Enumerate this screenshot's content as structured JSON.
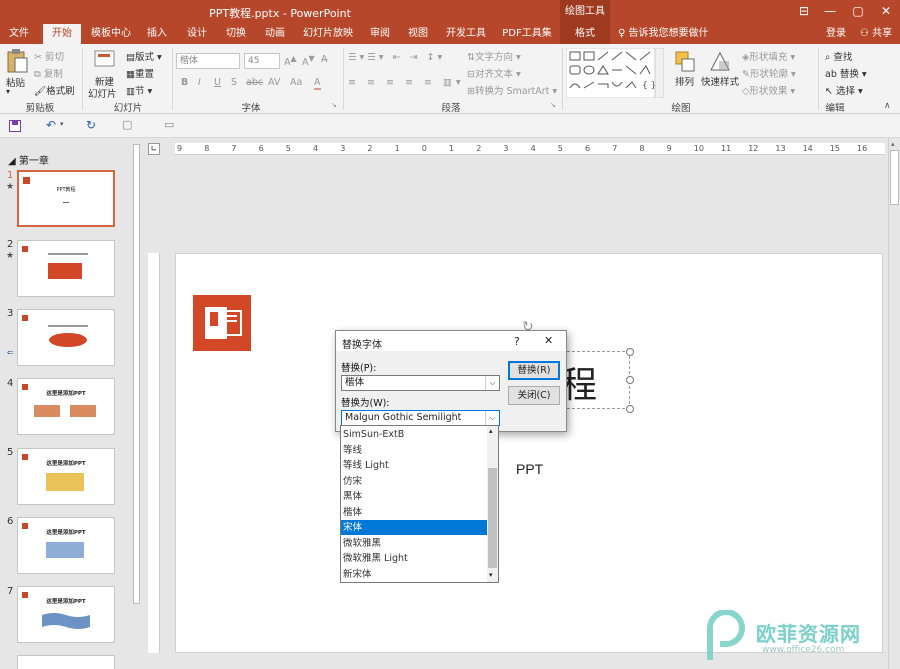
{
  "window": {
    "title": "PPT教程.pptx - PowerPoint",
    "contextual_group": "绘图工具",
    "minimize": "—",
    "restore": "▢",
    "close": "✕",
    "ribbon_options": "⊟"
  },
  "tabs": [
    "文件",
    "开始",
    "模板中心",
    "插入",
    "设计",
    "切换",
    "动画",
    "幻灯片放映",
    "审阅",
    "视图",
    "开发工具",
    "PDF工具集",
    "格式"
  ],
  "tell_me": "告诉我您想要做什么...",
  "account": {
    "login": "登录",
    "share": "共享"
  },
  "ribbon": {
    "clipboard": {
      "paste": "粘贴",
      "cut": "剪切",
      "copy": "复制",
      "format_painter": "格式刷",
      "title": "剪贴板"
    },
    "slides": {
      "new_slide": "新建",
      "new_slide2": "幻灯片",
      "layout": "版式",
      "reset": "重置",
      "section": "节",
      "title": "幻灯片"
    },
    "font": {
      "font_name": "楷体",
      "font_size": "45",
      "title": "字体",
      "bold": "B",
      "italic": "I",
      "underline": "U",
      "shadow": "S",
      "strike": "abc",
      "spacing": "AV",
      "case": "Aa",
      "color": "A"
    },
    "paragraph": {
      "text_direction": "文字方向",
      "align_text": "对齐文本",
      "smartart": "转换为 SmartArt",
      "title": "段落"
    },
    "drawing": {
      "arrange": "排列",
      "quick_styles": "快速样式",
      "shape_fill": "形状填充",
      "shape_outline": "形状轮廓",
      "shape_effects": "形状效果",
      "title": "绘图"
    },
    "editing": {
      "find": "查找",
      "replace": "替换",
      "select": "选择",
      "title": "编辑"
    }
  },
  "section_name": "第一章",
  "thumbnails": [
    {
      "num": "1",
      "star": "★",
      "caption": "PPT教程"
    },
    {
      "num": "2",
      "star": "★",
      "caption": ""
    },
    {
      "num": "3",
      "star": "",
      "caption": ""
    },
    {
      "num": "4",
      "star": "",
      "caption": "这里是添加PPT"
    },
    {
      "num": "5",
      "star": "",
      "caption": "这里是添加PPT"
    },
    {
      "num": "6",
      "star": "",
      "caption": "这里是添加PPT"
    },
    {
      "num": "7",
      "star": "",
      "caption": "这里是添加PPT"
    }
  ],
  "ruler_labels": [
    "9",
    "8",
    "7",
    "6",
    "5",
    "4",
    "3",
    "2",
    "1",
    "0",
    "1",
    "2",
    "3",
    "4",
    "5",
    "6",
    "7",
    "8",
    "9",
    "10",
    "11",
    "12",
    "13",
    "14",
    "15",
    "16"
  ],
  "slide": {
    "title_char": "程",
    "subtitle": "PPT"
  },
  "dialog": {
    "title": "替换字体",
    "help": "?",
    "close": "✕",
    "replace_label": "替换(P):",
    "replace_value": "楷体",
    "with_label": "替换为(W):",
    "with_value": "Malgun Gothic Semilight",
    "replace_button": "替换(R)",
    "close_button": "关闭(C)"
  },
  "dropdown_items": [
    "SimSun-ExtB",
    "等线",
    "等线 Light",
    "仿宋",
    "黑体",
    "楷体",
    "宋体",
    "微软雅黑",
    "微软雅黑 Light",
    "新宋体"
  ],
  "dropdown_selected_index": 6,
  "watermark": {
    "text": "欧菲资源网",
    "url": "www.office26.com"
  },
  "colors": {
    "accent": "#b7472a",
    "selection": "#0078d7",
    "thumb_selected": "#d7653e"
  }
}
